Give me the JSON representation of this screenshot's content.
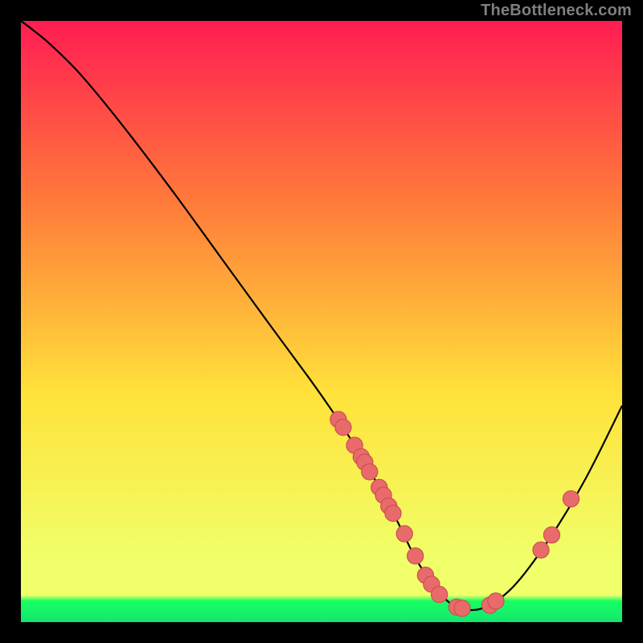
{
  "attribution": "TheBottleneck.com",
  "colors": {
    "bg_top": "#ff1d52",
    "bg_mid_upper": "#ff7a3a",
    "bg_mid": "#ffe23a",
    "bg_lower": "#f0ff6a",
    "bg_bottom_band": "#17ff62",
    "bg_bottom_edge": "#14e66e",
    "curve": "#000000",
    "dot_fill": "#e86a6a",
    "dot_stroke": "#c94f4f"
  },
  "chart_data": {
    "type": "line",
    "title": "",
    "xlabel": "",
    "ylabel": "",
    "xlim": [
      0,
      100
    ],
    "ylim": [
      0,
      100
    ],
    "series": [
      {
        "name": "bottleneck-curve",
        "x": [
          0,
          2,
          5,
          10,
          17,
          25,
          33,
          41,
          48,
          52,
          55,
          59,
          62.5,
          66,
          70,
          73,
          77,
          82,
          88,
          94,
          100
        ],
        "y": [
          100,
          98.5,
          96,
          91,
          82.5,
          72,
          61,
          50,
          40.5,
          34.8,
          30.2,
          23.5,
          17,
          10,
          4.5,
          2.3,
          2.4,
          6,
          14,
          24,
          36
        ]
      }
    ],
    "dots": {
      "name": "data-points",
      "points": [
        {
          "x": 52.8,
          "y": 33.7
        },
        {
          "x": 53.6,
          "y": 32.4
        },
        {
          "x": 55.5,
          "y": 29.4
        },
        {
          "x": 56.6,
          "y": 27.5
        },
        {
          "x": 57.2,
          "y": 26.6
        },
        {
          "x": 58.0,
          "y": 25.0
        },
        {
          "x": 59.6,
          "y": 22.4
        },
        {
          "x": 60.3,
          "y": 21.1
        },
        {
          "x": 61.2,
          "y": 19.3
        },
        {
          "x": 61.9,
          "y": 18.1
        },
        {
          "x": 63.8,
          "y": 14.7
        },
        {
          "x": 65.6,
          "y": 11.0
        },
        {
          "x": 67.3,
          "y": 7.8
        },
        {
          "x": 68.3,
          "y": 6.3
        },
        {
          "x": 69.6,
          "y": 4.6
        },
        {
          "x": 72.5,
          "y": 2.5
        },
        {
          "x": 73.4,
          "y": 2.3
        },
        {
          "x": 78.0,
          "y": 2.8
        },
        {
          "x": 79.0,
          "y": 3.5
        },
        {
          "x": 86.5,
          "y": 12.0
        },
        {
          "x": 88.3,
          "y": 14.5
        },
        {
          "x": 91.5,
          "y": 20.5
        }
      ],
      "r": 1.35
    }
  }
}
